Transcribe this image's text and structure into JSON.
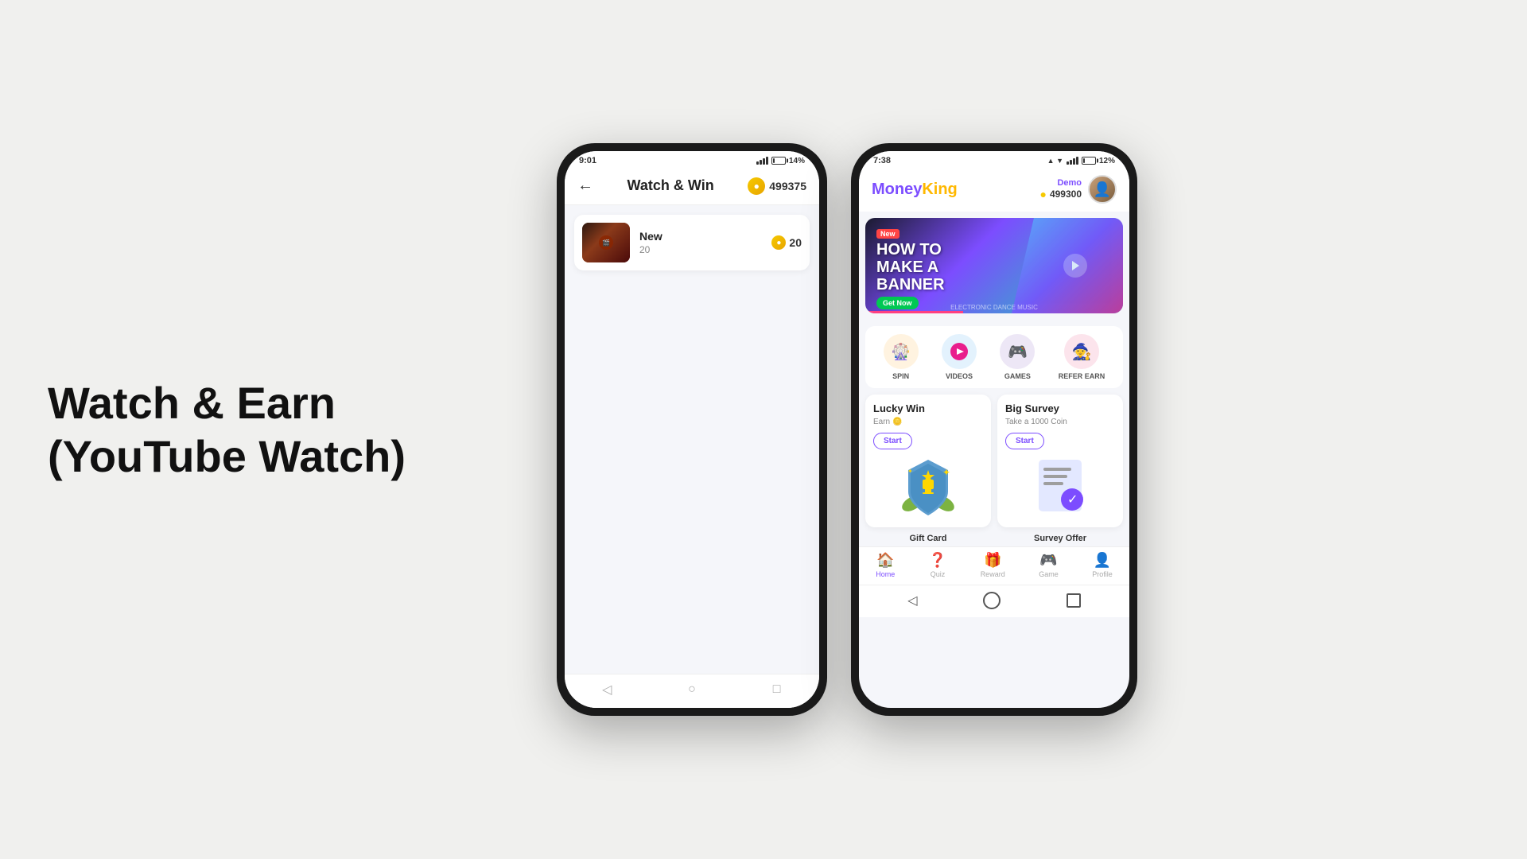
{
  "page": {
    "background": "#f0f0ee"
  },
  "left": {
    "title_line1": "Watch & Earn",
    "title_line2": "(YouTube Watch)"
  },
  "phone1": {
    "status": {
      "time": "9:01",
      "battery": "14%",
      "battery_pct": 14
    },
    "header": {
      "title": "Watch & Win",
      "coins": "499375"
    },
    "video_item": {
      "title": "New",
      "subtitle": "20",
      "reward": "20"
    },
    "nav_buttons": {
      "back": "◁",
      "home": "○",
      "recent": "□"
    }
  },
  "phone2": {
    "status": {
      "time": "7:38",
      "battery": "12%",
      "battery_pct": 12
    },
    "header": {
      "logo_money": "Money",
      "logo_king": "King",
      "user": "Demo",
      "coins": "499300"
    },
    "banner": {
      "new_label": "New",
      "title_line1": "HOW TO",
      "title_line2": "MAKE A",
      "title_line3": "BANNER",
      "get_now": "Get Now",
      "sub_text": "ELECTRONIC DANCE MUSIC"
    },
    "icons": [
      {
        "label": "SPIN",
        "emoji": "🎡",
        "color": "#fff3e0"
      },
      {
        "label": "VIDEOS",
        "emoji": "▶️",
        "color": "#e8f5e9"
      },
      {
        "label": "GAMES",
        "emoji": "🎮",
        "color": "#ede7f6"
      },
      {
        "label": "REFER EARN",
        "emoji": "🧙",
        "color": "#fce4ec"
      }
    ],
    "lucky_win": {
      "title": "Lucky Win",
      "desc": "Earn",
      "start": "Start"
    },
    "big_survey": {
      "title": "Big Survey",
      "desc": "Take a 1000 Coin",
      "start": "Start"
    },
    "bottom_sections": [
      {
        "title": "Gift Card"
      },
      {
        "title": "Survey Offer"
      }
    ],
    "nav": [
      {
        "label": "Home",
        "active": true
      },
      {
        "label": "Quiz",
        "active": false
      },
      {
        "label": "Reward",
        "active": false
      },
      {
        "label": "Game",
        "active": false
      },
      {
        "label": "Profile",
        "active": false
      }
    ]
  }
}
